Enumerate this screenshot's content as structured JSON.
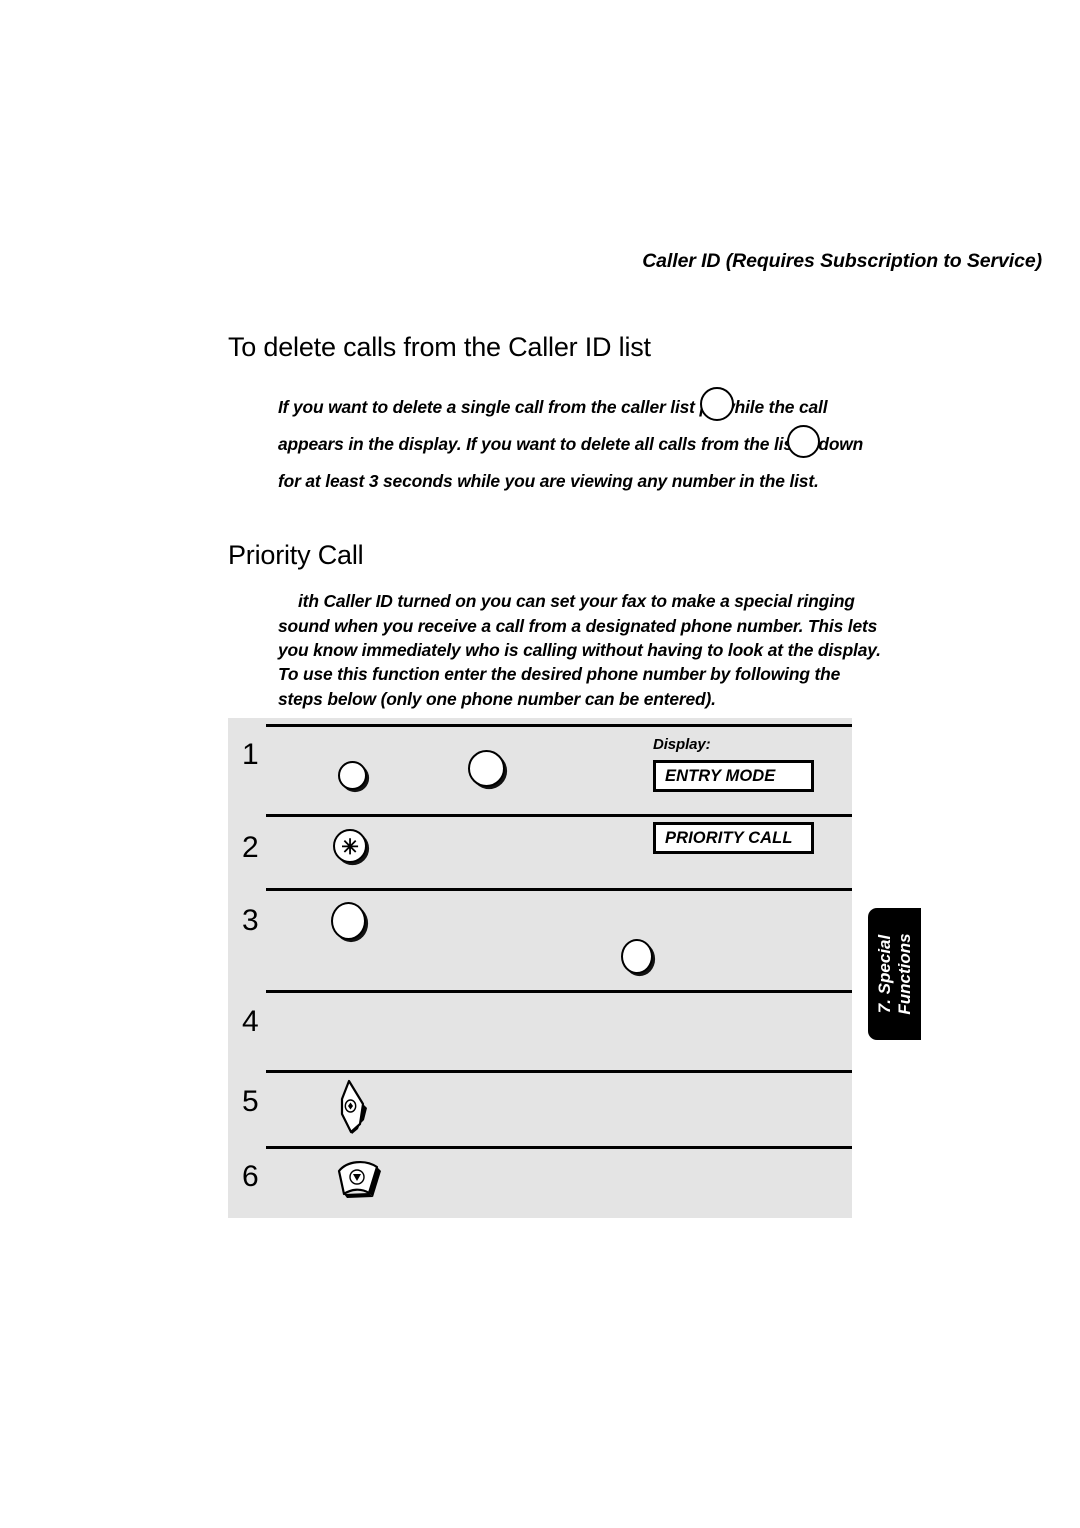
{
  "running_head": "Caller ID (Requires Subscription to Service)",
  "sections": [
    {
      "heading": "To delete calls from the Caller ID list",
      "paragraphs": [
        "If you want to delete a single call from the caller list  pr                while the call appears in the display. If you want to delete all calls from the list        d down for at least 3 seconds while you are viewing any number in the list."
      ]
    },
    {
      "heading": "Priority Call",
      "paragraphs": [
        "ith Caller ID turned on  you can set your fax to make a special ringing sound when you receive a call from a designated phone number. This lets you know immediately who is calling without having to look at the display.",
        "To use this function  enter the desired phone number by following the steps below (only one phone number can be entered)."
      ]
    }
  ],
  "steps_table": {
    "display_label": "Display:",
    "rows": [
      {
        "number": "1",
        "keys": [
          "round-key",
          "round-key"
        ],
        "display_value": "ENTRY MODE"
      },
      {
        "number": "2",
        "keys": [
          "asterisk-key"
        ],
        "key_glyph": "✳",
        "display_value": "PRIORITY CALL"
      },
      {
        "number": "3",
        "keys": [
          "round-key",
          "round-key"
        ],
        "display_value": ""
      },
      {
        "number": "4",
        "keys": [],
        "display_value": ""
      },
      {
        "number": "5",
        "keys": [
          "wedge-key-narrow"
        ],
        "display_value": ""
      },
      {
        "number": "6",
        "keys": [
          "wedge-key-wide"
        ],
        "display_value": ""
      }
    ]
  },
  "side_tab": {
    "line1": "7. Special",
    "line2": "Functions"
  },
  "colors": {
    "table_background": "#e4e4e4",
    "rule": "#000000",
    "side_tab_background": "#000000",
    "side_tab_text": "#ffffff",
    "page_background": "#ffffff"
  }
}
